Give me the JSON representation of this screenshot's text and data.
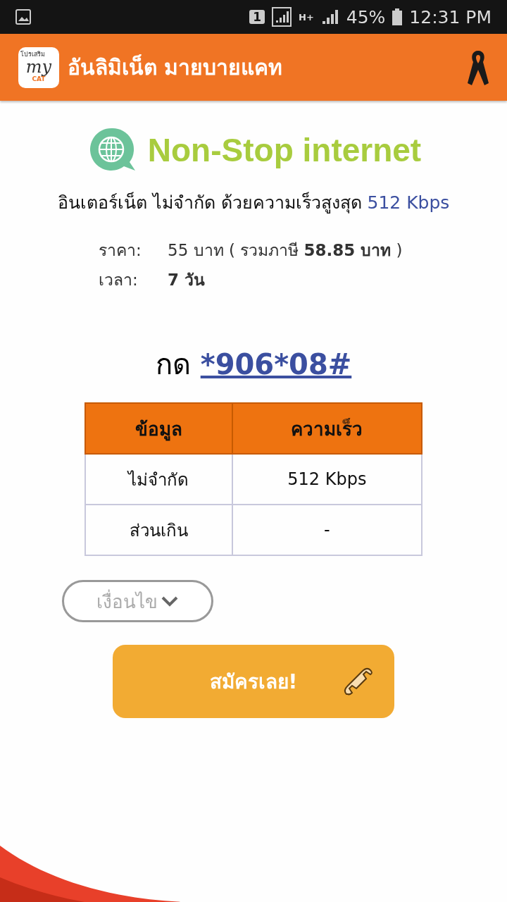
{
  "status_bar": {
    "sim": "1",
    "network": "H+",
    "battery": "45%",
    "time": "12:31 PM"
  },
  "app_bar": {
    "logo": {
      "top": "โปรเสริม",
      "main": "my",
      "bottom": "CAT"
    },
    "title": "อันลิมิเน็ต มายบายแคท"
  },
  "banner": {
    "text": "Non-Stop internet"
  },
  "headline": {
    "text": "อินเตอร์เน็ต ไม่จำกัด ด้วยความเร็วสูงสุด",
    "speed": "512 Kbps"
  },
  "details": [
    {
      "label": "ราคา:",
      "value": "55 บาท ( รวมภาษี **58.85 บาท** )"
    },
    {
      "label": "เวลา:",
      "value": "**7 วัน**"
    }
  ],
  "dial": {
    "prefix": "กด",
    "code": "*906*08#"
  },
  "table": {
    "columns": [
      "ข้อมูล",
      "ความเร็ว"
    ],
    "rows": [
      [
        "ไม่จำกัด",
        "512 Kbps"
      ],
      [
        "ส่วนเกิน",
        "-"
      ]
    ]
  },
  "conditions": {
    "label": "เงื่อนไข",
    "expanded": false
  },
  "register_button": {
    "label": "สมัครเลย!"
  }
}
